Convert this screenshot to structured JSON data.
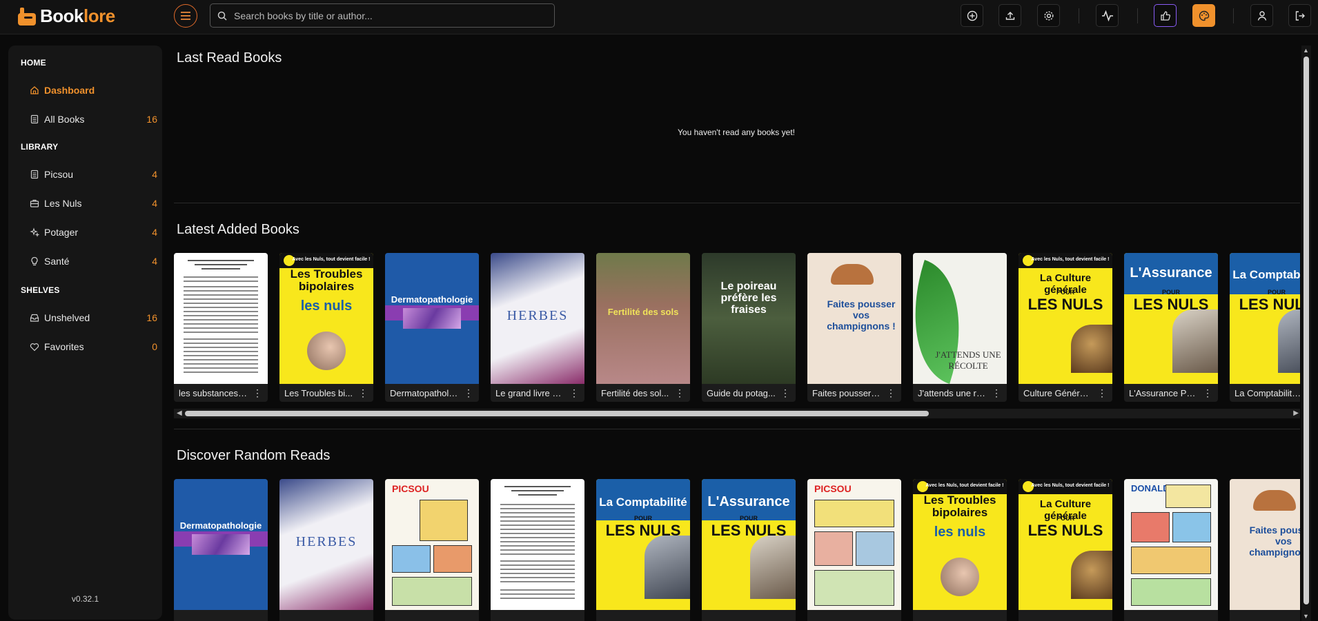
{
  "app": {
    "name_part1": "Book",
    "name_part2": "lore",
    "version": "v0.32.1"
  },
  "search": {
    "placeholder": "Search books by title or author..."
  },
  "sidebar": {
    "sections": [
      {
        "title": "HOME"
      },
      {
        "title": "LIBRARY"
      },
      {
        "title": "SHELVES"
      }
    ],
    "items": [
      {
        "label": "Dashboard",
        "count": "",
        "icon": "home-icon"
      },
      {
        "label": "All Books",
        "count": "16",
        "icon": "book-icon"
      },
      {
        "label": "Picsou",
        "count": "4",
        "icon": "book-icon"
      },
      {
        "label": "Les Nuls",
        "count": "4",
        "icon": "briefcase-icon"
      },
      {
        "label": "Potager",
        "count": "4",
        "icon": "sparkle-icon"
      },
      {
        "label": "Santé",
        "count": "4",
        "icon": "lightbulb-icon"
      },
      {
        "label": "Unshelved",
        "count": "16",
        "icon": "inbox-icon"
      },
      {
        "label": "Favorites",
        "count": "0",
        "icon": "heart-icon"
      }
    ]
  },
  "sections": {
    "last_read": {
      "title": "Last Read Books",
      "empty_message": "You haven't read any books yet!"
    },
    "latest_added": {
      "title": "Latest Added Books"
    },
    "discover": {
      "title": "Discover Random Reads"
    }
  },
  "latest_books": [
    {
      "title": "les substances ...",
      "cover": "doc"
    },
    {
      "title": "Les Troubles bi...",
      "cover": "nuls-bipolaires"
    },
    {
      "title": "Dermatopatholo...",
      "cover": "derm"
    },
    {
      "title": "Le grand livre d...",
      "cover": "herbes"
    },
    {
      "title": "Fertilité des sol...",
      "cover": "fertilite"
    },
    {
      "title": "Guide du potag...",
      "cover": "poireau"
    },
    {
      "title": "Faites pousser v...",
      "cover": "champignons"
    },
    {
      "title": "J'attends une ré...",
      "cover": "recolte"
    },
    {
      "title": "Culture Général...",
      "cover": "nuls-culture"
    },
    {
      "title": "L'Assurance Pou...",
      "cover": "nuls-assurance"
    },
    {
      "title": "La Comptabilité ...",
      "cover": "nuls-compta"
    }
  ],
  "discover_books": [
    {
      "title": "",
      "cover": "derm"
    },
    {
      "title": "",
      "cover": "herbes"
    },
    {
      "title": "",
      "cover": "picsou1"
    },
    {
      "title": "",
      "cover": "doc"
    },
    {
      "title": "",
      "cover": "nuls-compta"
    },
    {
      "title": "",
      "cover": "nuls-assurance"
    },
    {
      "title": "",
      "cover": "picsou2"
    },
    {
      "title": "",
      "cover": "nuls-bipolaires"
    },
    {
      "title": "",
      "cover": "nuls-culture"
    },
    {
      "title": "",
      "cover": "donald"
    },
    {
      "title": "",
      "cover": "champignons"
    }
  ],
  "cover_text": {
    "nuls_band": "Avec les Nuls, tout devient facile !",
    "nuls_pour": "POUR",
    "nuls_les_nuls": "LES NULS",
    "nuls_lower": "les nuls",
    "bipolaires": "Les Troubles bipolaires",
    "culture": "La Culture générale",
    "assurance": "L'Assurance",
    "compta": "La Comptabilité",
    "derm": "Dermatopathologie",
    "herbes": "HERBES",
    "fertilite": "Fertilité des sols",
    "poireau": "Le poireau préfère les fraises",
    "champignons": "Faites pousser vos champignons !",
    "recolte": "J'ATTENDS UNE RÉCOLTE",
    "picsou": "PICSOU",
    "donald": "DONALD"
  },
  "colors": {
    "accent": "#f0912c",
    "background": "#0a0a0a",
    "sidebar": "#161616"
  }
}
